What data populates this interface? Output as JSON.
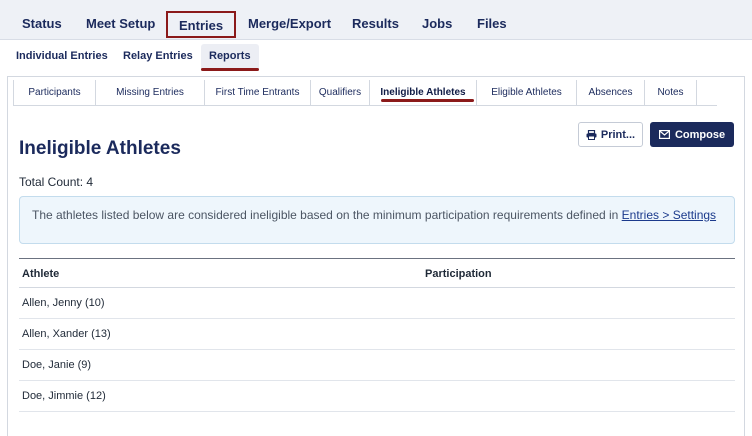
{
  "main_nav": {
    "items": [
      {
        "label": "Status"
      },
      {
        "label": "Meet Setup"
      },
      {
        "label": "Entries"
      },
      {
        "label": "Merge/Export"
      },
      {
        "label": "Results"
      },
      {
        "label": "Jobs"
      },
      {
        "label": "Files"
      }
    ],
    "active": "Entries"
  },
  "sub_nav": {
    "items": [
      {
        "label": "Individual Entries"
      },
      {
        "label": "Relay Entries"
      },
      {
        "label": "Reports"
      }
    ],
    "active": "Reports"
  },
  "report_tabs": {
    "items": [
      {
        "label": "Participants"
      },
      {
        "label": "Missing Entries"
      },
      {
        "label": "First Time Entrants"
      },
      {
        "label": "Qualifiers"
      },
      {
        "label": "Ineligible Athletes"
      },
      {
        "label": "Eligible Athletes"
      },
      {
        "label": "Absences"
      },
      {
        "label": "Notes"
      }
    ],
    "active": "Ineligible Athletes"
  },
  "actions": {
    "print_label": "Print...",
    "compose_label": "Compose",
    "print_icon": "printer-icon",
    "compose_icon": "envelope-icon"
  },
  "page": {
    "title": "Ineligible Athletes",
    "total_count_label": "Total Count:",
    "total_count": "4"
  },
  "info": {
    "text": "The athletes listed below are considered ineligible based on the minimum participation requirements defined in ",
    "link_text": "Entries > Settings"
  },
  "table": {
    "columns": [
      "Athlete",
      "Participation"
    ],
    "rows": [
      {
        "athlete": "Allen, Jenny (10)",
        "participation": ""
      },
      {
        "athlete": "Allen, Xander (13)",
        "participation": ""
      },
      {
        "athlete": "Doe, Janie (9)",
        "participation": ""
      },
      {
        "athlete": "Doe, Jimmie (12)",
        "participation": ""
      }
    ]
  },
  "colors": {
    "navy": "#1b2a5c",
    "accent_red": "#8b1a1a",
    "info_bg": "#eef6fc"
  }
}
